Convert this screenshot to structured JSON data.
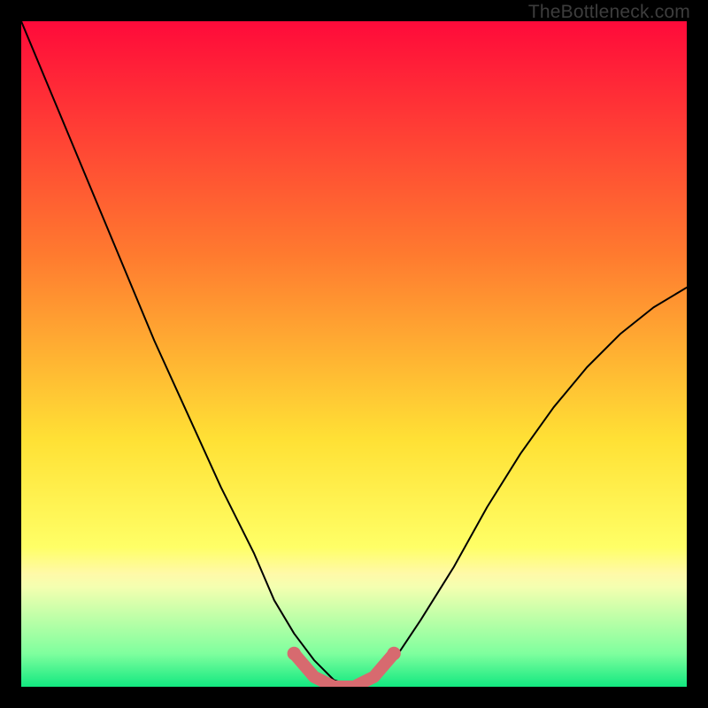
{
  "watermark": "TheBottleneck.com",
  "chart_data": {
    "type": "line",
    "title": "",
    "xlabel": "",
    "ylabel": "",
    "xlim": [
      0,
      100
    ],
    "ylim": [
      0,
      100
    ],
    "background": {
      "type": "vertical-gradient",
      "stops": [
        {
          "pos": 0,
          "color": "#ff0a3a"
        },
        {
          "pos": 35,
          "color": "#ff7a2f"
        },
        {
          "pos": 63,
          "color": "#ffe135"
        },
        {
          "pos": 79,
          "color": "#ffff66"
        },
        {
          "pos": 83,
          "color": "#fff9a8"
        },
        {
          "pos": 85,
          "color": "#f4ffb0"
        },
        {
          "pos": 95,
          "color": "#7fff9e"
        },
        {
          "pos": 100,
          "color": "#12e880"
        }
      ]
    },
    "series": [
      {
        "name": "bottleneck-curve",
        "color": "#000000",
        "width": 2,
        "x": [
          0,
          5,
          10,
          15,
          20,
          25,
          30,
          35,
          38,
          41,
          44,
          47,
          50,
          53,
          56,
          60,
          65,
          70,
          75,
          80,
          85,
          90,
          95,
          100
        ],
        "y": [
          100,
          88,
          76,
          64,
          52,
          41,
          30,
          20,
          13,
          8,
          4,
          1,
          0,
          1,
          4,
          10,
          18,
          27,
          35,
          42,
          48,
          53,
          57,
          60
        ]
      },
      {
        "name": "optimal-zone-marker",
        "color": "#d76a6f",
        "width": 14,
        "x": [
          41,
          44,
          47,
          50,
          53,
          56
        ],
        "y": [
          5,
          1.5,
          0,
          0,
          1.5,
          5
        ],
        "endpoints": true
      }
    ]
  }
}
